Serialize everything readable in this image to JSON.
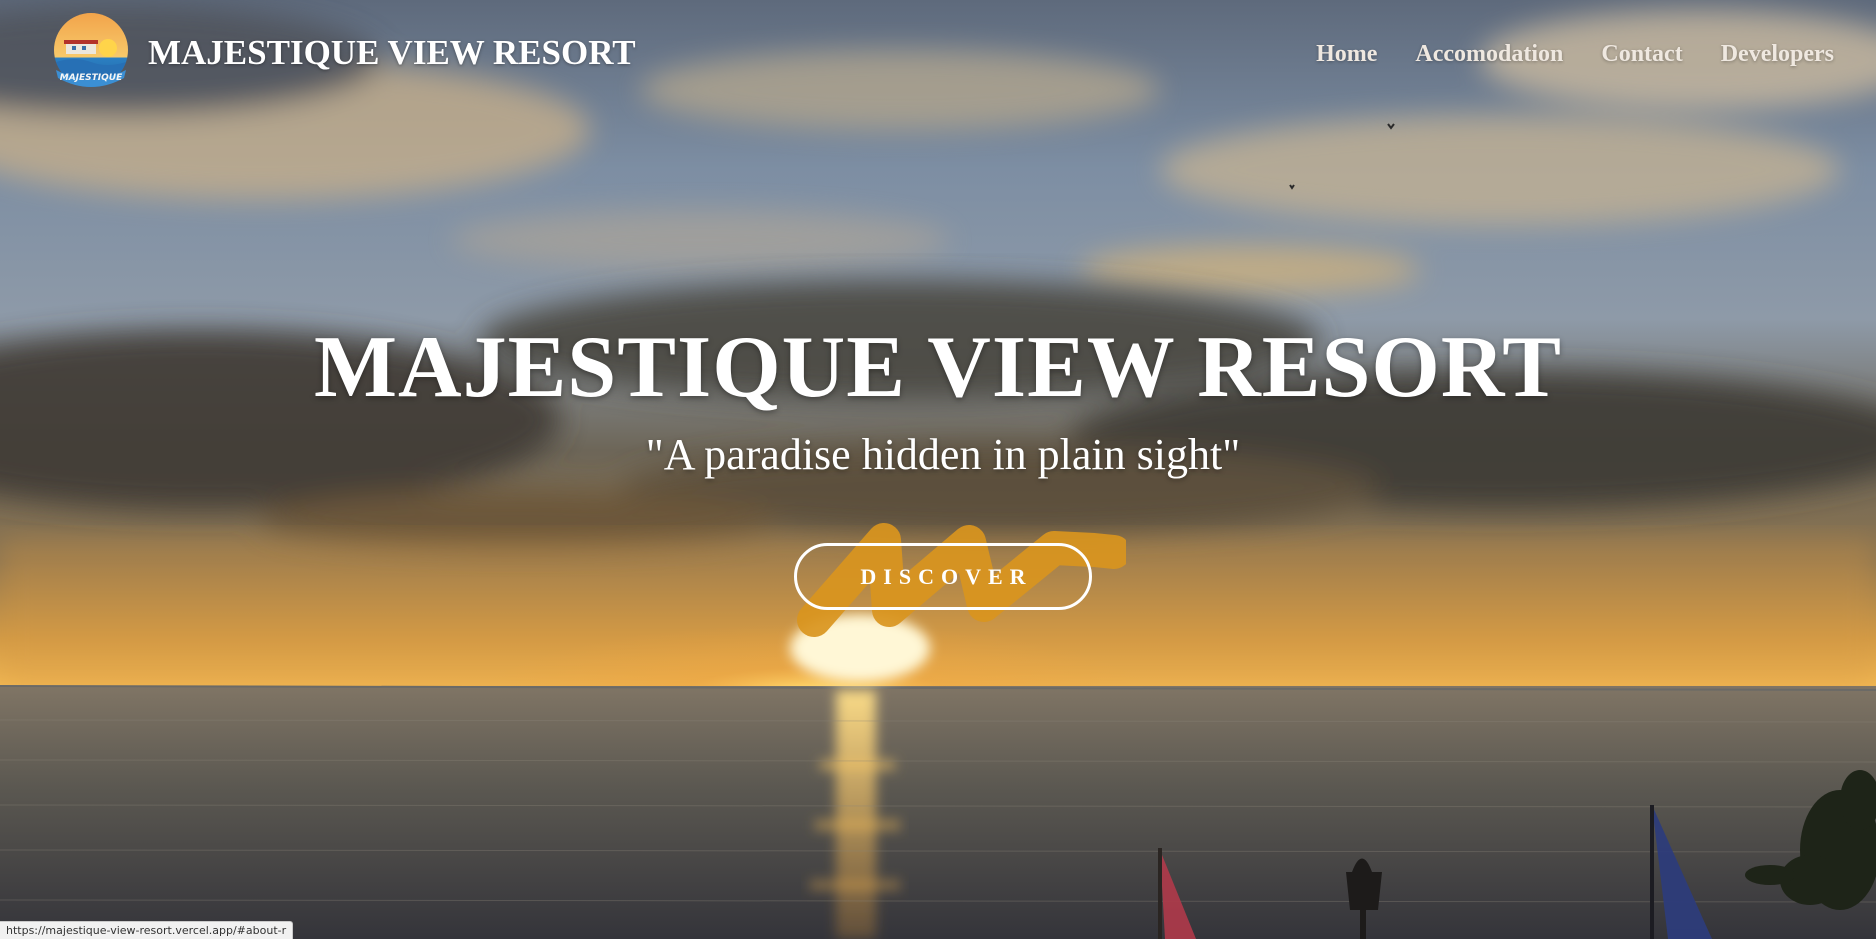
{
  "header": {
    "brand": "MAJESTIQUE VIEW RESORT",
    "logo_text": "MAJESTIQUE",
    "nav": [
      {
        "label": "Home"
      },
      {
        "label": "Accomodation"
      },
      {
        "label": "Contact"
      },
      {
        "label": "Developers"
      }
    ]
  },
  "hero": {
    "title": "MAJESTIQUE VIEW RESORT",
    "tagline": "\"A paradise hidden in plain sight\"",
    "cta_label": "DISCOVER"
  },
  "status_bar": {
    "url": "https://majestique-view-resort.vercel.app/#about-r"
  },
  "colors": {
    "accent": "#d9951e",
    "text": "#ffffff",
    "nav_text": "#efe8e0"
  }
}
